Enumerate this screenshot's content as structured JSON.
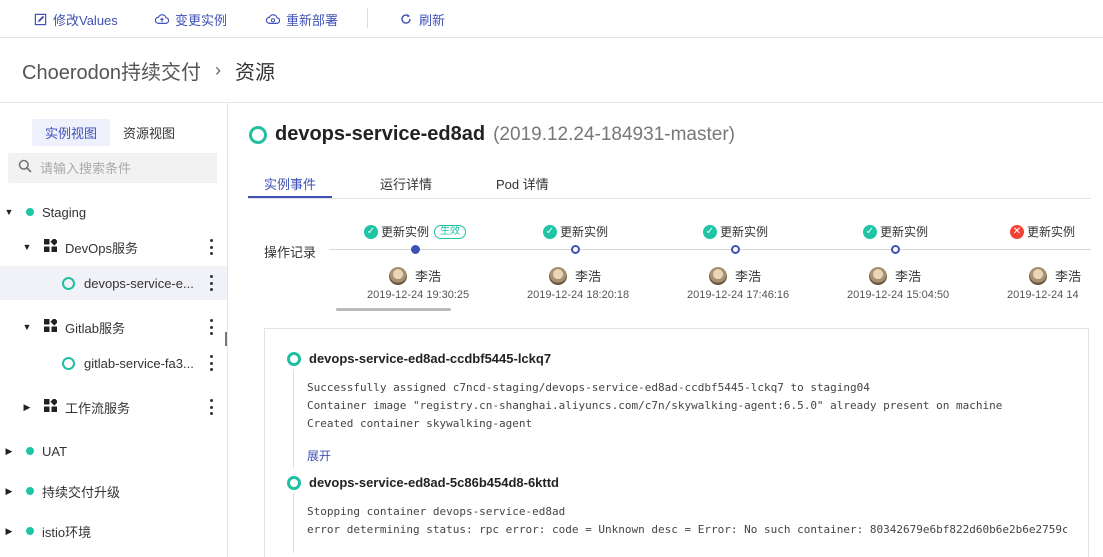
{
  "toolbar": {
    "modify_values": "修改Values",
    "change_instance": "变更实例",
    "redeploy": "重新部署",
    "refresh": "刷新"
  },
  "header": {
    "app": "Choerodon持续交付",
    "page": "资源"
  },
  "sidebar": {
    "view_tabs": [
      "实例视图",
      "资源视图"
    ],
    "search_placeholder": "请输入搜索条件",
    "tree": {
      "staging": "Staging",
      "devops_service": "DevOps服务",
      "devops_instance": "devops-service-e...",
      "gitlab_service": "Gitlab服务",
      "gitlab_instance": "gitlab-service-fa3...",
      "workflow_service": "工作流服务",
      "uat": "UAT",
      "cd_upgrade": "持续交付升级",
      "istio": "istio环境"
    }
  },
  "instance": {
    "name": "devops-service-ed8ad",
    "version": "(2019.12.24-184931-master)"
  },
  "tabs": [
    "实例事件",
    "运行详情",
    "Pod 详情"
  ],
  "timeline": {
    "label": "操作记录",
    "items": [
      {
        "title": "更新实例",
        "status": "ok",
        "tag": "生效",
        "user": "李浩",
        "time": "2019-12-24 19:30:25"
      },
      {
        "title": "更新实例",
        "status": "ok",
        "user": "李浩",
        "time": "2019-12-24 18:20:18"
      },
      {
        "title": "更新实例",
        "status": "ok",
        "user": "李浩",
        "time": "2019-12-24 17:46:16"
      },
      {
        "title": "更新实例",
        "status": "ok",
        "user": "李浩",
        "time": "2019-12-24 15:04:50"
      },
      {
        "title": "更新实例",
        "status": "error",
        "user": "李浩",
        "time": "2019-12-24 14"
      }
    ]
  },
  "events": {
    "pod1": {
      "name": "devops-service-ed8ad-ccdbf5445-lckq7",
      "logs": [
        "Successfully assigned c7ncd-staging/devops-service-ed8ad-ccdbf5445-lckq7 to staging04",
        "Container image \"registry.cn-shanghai.aliyuncs.com/c7n/skywalking-agent:6.5.0\" already present on machine",
        "Created container skywalking-agent"
      ],
      "expand": "展开"
    },
    "pod2": {
      "name": "devops-service-ed8ad-5c86b454d8-6kttd",
      "logs": [
        "Stopping container devops-service-ed8ad",
        "error determining status: rpc error: code = Unknown desc = Error: No such container: 80342679e6bf822d60b6e2b6e2759c"
      ]
    }
  },
  "colors": {
    "accent": "#3f51b5",
    "success": "#1dc5a5",
    "error": "#f44336"
  }
}
